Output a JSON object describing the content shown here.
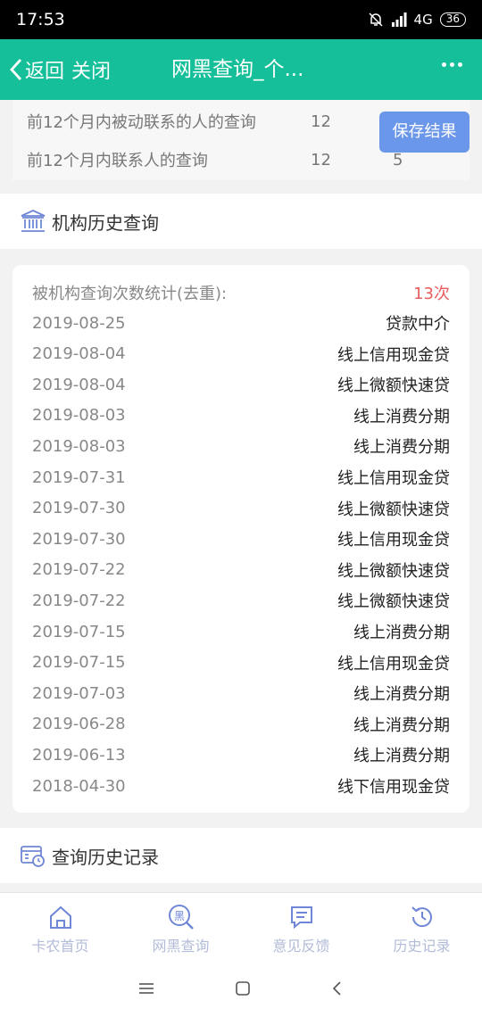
{
  "status_bar": {
    "time": "17:53",
    "network": "4G",
    "battery": "36"
  },
  "header": {
    "back_label": "返回",
    "close_label": "关闭",
    "title": "网黑查询_个..."
  },
  "top_card": {
    "rows": [
      {
        "label": "前12个月内被动联系的人的查询",
        "value1": "12",
        "value2": ""
      },
      {
        "label": "前12个月内联系人的查询",
        "value1": "12",
        "value2": "5"
      }
    ],
    "save_button": "保存结果"
  },
  "institution_section": {
    "title": "机构历史查询",
    "summary_label": "被机构查询次数统计(去重):",
    "summary_value": "13次",
    "records": [
      {
        "date": "2019-08-25",
        "type": "贷款中介"
      },
      {
        "date": "2019-08-04",
        "type": "线上信用现金贷"
      },
      {
        "date": "2019-08-04",
        "type": "线上微额快速贷"
      },
      {
        "date": "2019-08-03",
        "type": "线上消费分期"
      },
      {
        "date": "2019-08-03",
        "type": "线上消费分期"
      },
      {
        "date": "2019-07-31",
        "type": "线上信用现金贷"
      },
      {
        "date": "2019-07-30",
        "type": "线上微额快速贷"
      },
      {
        "date": "2019-07-30",
        "type": "线上信用现金贷"
      },
      {
        "date": "2019-07-22",
        "type": "线上微额快速贷"
      },
      {
        "date": "2019-07-22",
        "type": "线上微额快速贷"
      },
      {
        "date": "2019-07-15",
        "type": "线上消费分期"
      },
      {
        "date": "2019-07-15",
        "type": "线上信用现金贷"
      },
      {
        "date": "2019-07-03",
        "type": "线上消费分期"
      },
      {
        "date": "2019-06-28",
        "type": "线上消费分期"
      },
      {
        "date": "2019-06-13",
        "type": "线上消费分期"
      },
      {
        "date": "2018-04-30",
        "type": "线下信用现金贷"
      }
    ]
  },
  "history_section": {
    "title": "查询历史记录"
  },
  "tab_bar": {
    "tabs": [
      {
        "label": "卡农首页",
        "icon": "home-icon"
      },
      {
        "label": "网黑查询",
        "icon": "search-black-icon"
      },
      {
        "label": "意见反馈",
        "icon": "feedback-icon"
      },
      {
        "label": "历史记录",
        "icon": "history-icon"
      }
    ]
  },
  "colors": {
    "header": "#15bf9a",
    "save_button": "#6b97ea",
    "accent_red": "#e85d5d",
    "tab_icon": "#6f87d6",
    "tab_label": "#b2bcd8"
  }
}
